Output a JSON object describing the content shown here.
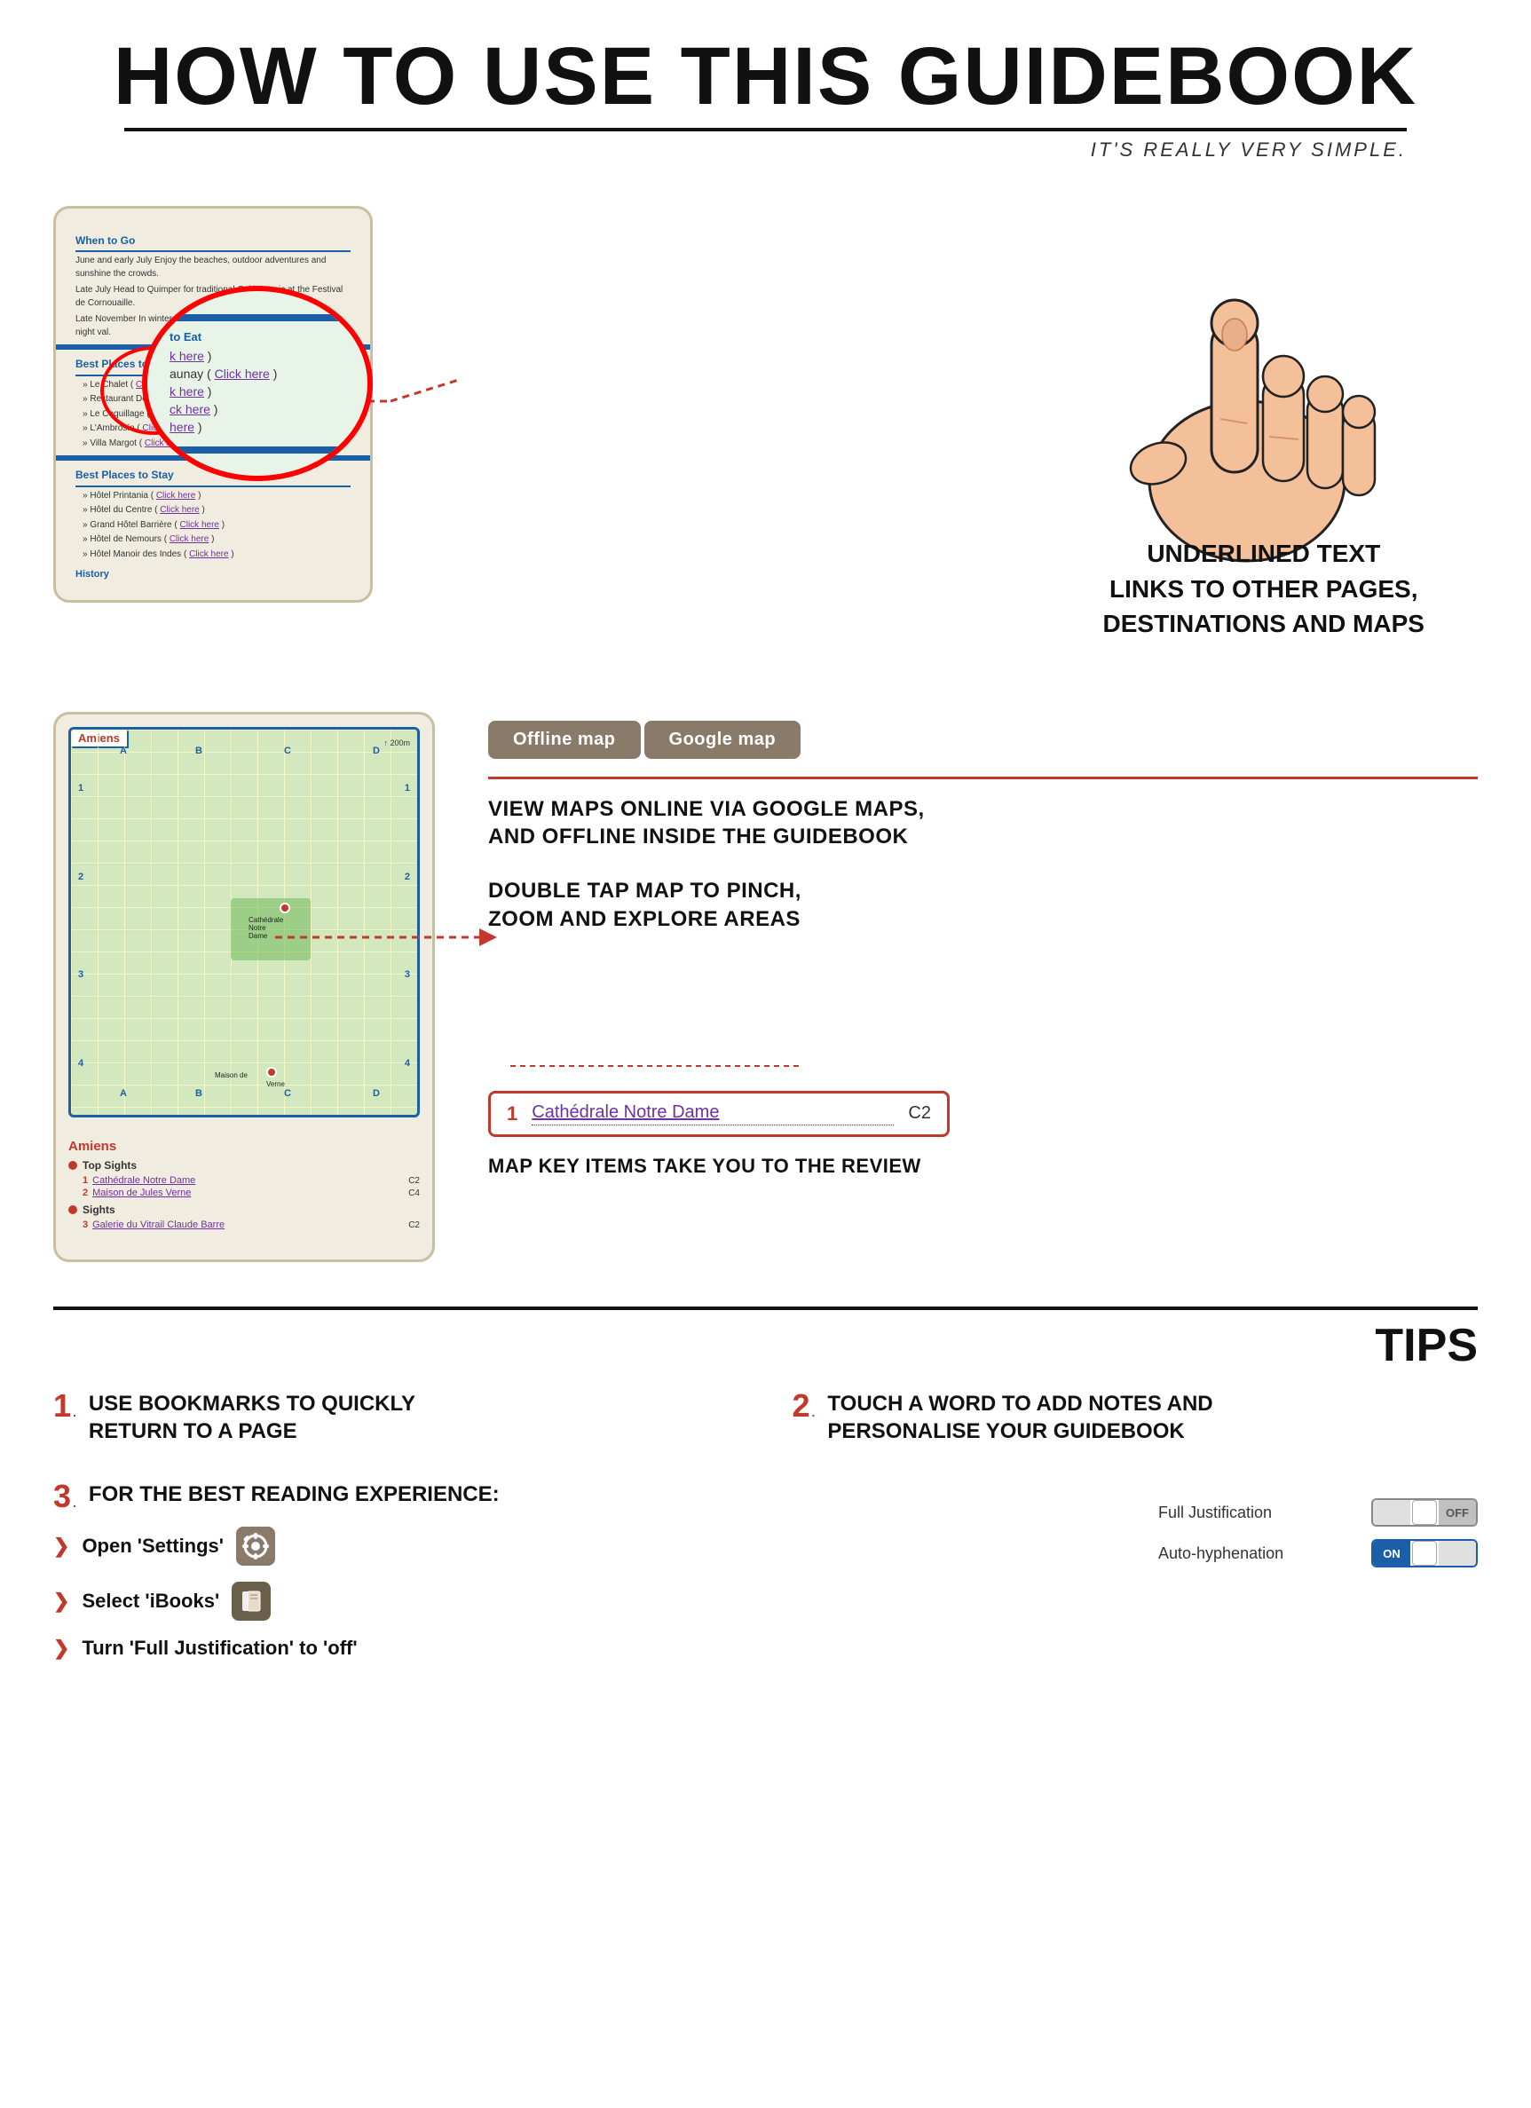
{
  "header": {
    "title": "HOW TO USE THIS GUIDEBOOK",
    "subtitle": "IT'S REALLY VERY SIMPLE.",
    "divider": true
  },
  "section1": {
    "mockup": {
      "when_to_go_title": "When to Go",
      "when_to_go_body1": "June and early July Enjoy the beaches, outdoor adventures and sunshine the crowds.",
      "when_to_go_body2": "Late July Head to Quimper for traditional Celtic music at the Festival de Cornouaille.",
      "when_to_go_body3": "Late November In winter, join the crowds in Rennes for the Yaouank night val.",
      "best_eat_title": "Best Places to Eat",
      "best_eat_items": [
        {
          "text": "Le Chalet ( ",
          "link": "Click here",
          "suffix": " )"
        },
        {
          "text": "Restaurant Delaunay ( ",
          "link": "Click here",
          "suffix": " )"
        },
        {
          "text": "Le Coquillage ( ",
          "link": "Click here",
          "suffix": " )"
        },
        {
          "text": "L'Ambrosín ( ",
          "link": "Click here",
          "suffix": " )"
        },
        {
          "text": "Villa Margot ( ",
          "link": "Click here",
          "suffix": " )"
        }
      ],
      "best_stay_title": "Best Places to Stay",
      "best_stay_items": [
        {
          "text": "Hôtel Printania ( ",
          "link": "Click here",
          "suffix": " )"
        },
        {
          "text": "Hôtel du Centre ( ",
          "link": "Click here",
          "suffix": " )"
        },
        {
          "text": "Grand Hôtel Barrière ( ",
          "link": "Click here",
          "suffix": " )"
        },
        {
          "text": "Hôtel de Nemours ( ",
          "link": "Click here",
          "suffix": " )"
        },
        {
          "text": "Hôtel Manoir des Indes ( ",
          "link": "Click here",
          "suffix": " )"
        }
      ],
      "history_label": "History"
    },
    "zoom": {
      "heading": "to Eat",
      "lines": [
        {
          "text": "k here",
          "link": true
        },
        {
          "prefix": "aunay ( ",
          "link_text": "Click here",
          "suffix": " )"
        },
        {
          "text": "k here",
          "link": true
        },
        {
          "text": "ck here",
          "link": true
        },
        {
          "text": "here",
          "link": true
        }
      ]
    },
    "description": {
      "line1": "UNDERLINED TEXT",
      "line2": "LINKS TO OTHER PAGES,",
      "line3": "DESTINATIONS AND MAPS"
    }
  },
  "section2": {
    "buttons": {
      "offline_map": "Offline map",
      "google_map": "Google map"
    },
    "info_text": "VIEW MAPS ONLINE VIA GOOGLE MAPS,\nAND OFFLINE INSIDE THE GUIDEBOOK",
    "zoom_text": "DOUBLE TAP MAP TO PINCH,\nZOOM AND EXPLORE AREAS",
    "map_key_caption": "MAP KEY ITEMS TAKE YOU TO THE REVIEW",
    "highlight": {
      "num": "1",
      "name": "Cathédrale Notre Dame",
      "coord": "C2"
    },
    "map": {
      "city": "Amiens",
      "categories": [
        {
          "label": "Top Sights",
          "items": [
            {
              "num": "1",
              "name": "Cathédrale Notre Dame",
              "coord": "C2"
            },
            {
              "num": "2",
              "name": "Maison de Jules Verne",
              "coord": "C4"
            }
          ]
        },
        {
          "label": "Sights",
          "items": [
            {
              "num": "3",
              "name": "Galerie du Vitrail Claude Barre",
              "coord": "C2"
            }
          ]
        }
      ]
    }
  },
  "tips": {
    "label": "TIPS",
    "items": [
      {
        "num": "1",
        "text": "USE BOOKMARKS TO QUICKLY\nRETURN TO A PAGE"
      },
      {
        "num": "2",
        "text": "TOUCH A WORD TO ADD NOTES AND\nPERSONALISE YOUR GUIDEBOOK"
      }
    ],
    "tip3": {
      "num": "3",
      "header": "FOR THE BEST READING EXPERIENCE:",
      "sub_items": [
        {
          "text": "Open 'Settings'",
          "icon": "⚙",
          "icon_bg": "settings"
        },
        {
          "text": "Select 'iBooks'",
          "icon": "📖",
          "icon_bg": "books"
        },
        {
          "text": "Turn 'Full Justification' to 'off'",
          "icon": null
        }
      ]
    },
    "toggles": [
      {
        "label": "Full Justification",
        "state": "OFF"
      },
      {
        "label": "Auto-hyphenation",
        "state": "ON"
      }
    ]
  }
}
